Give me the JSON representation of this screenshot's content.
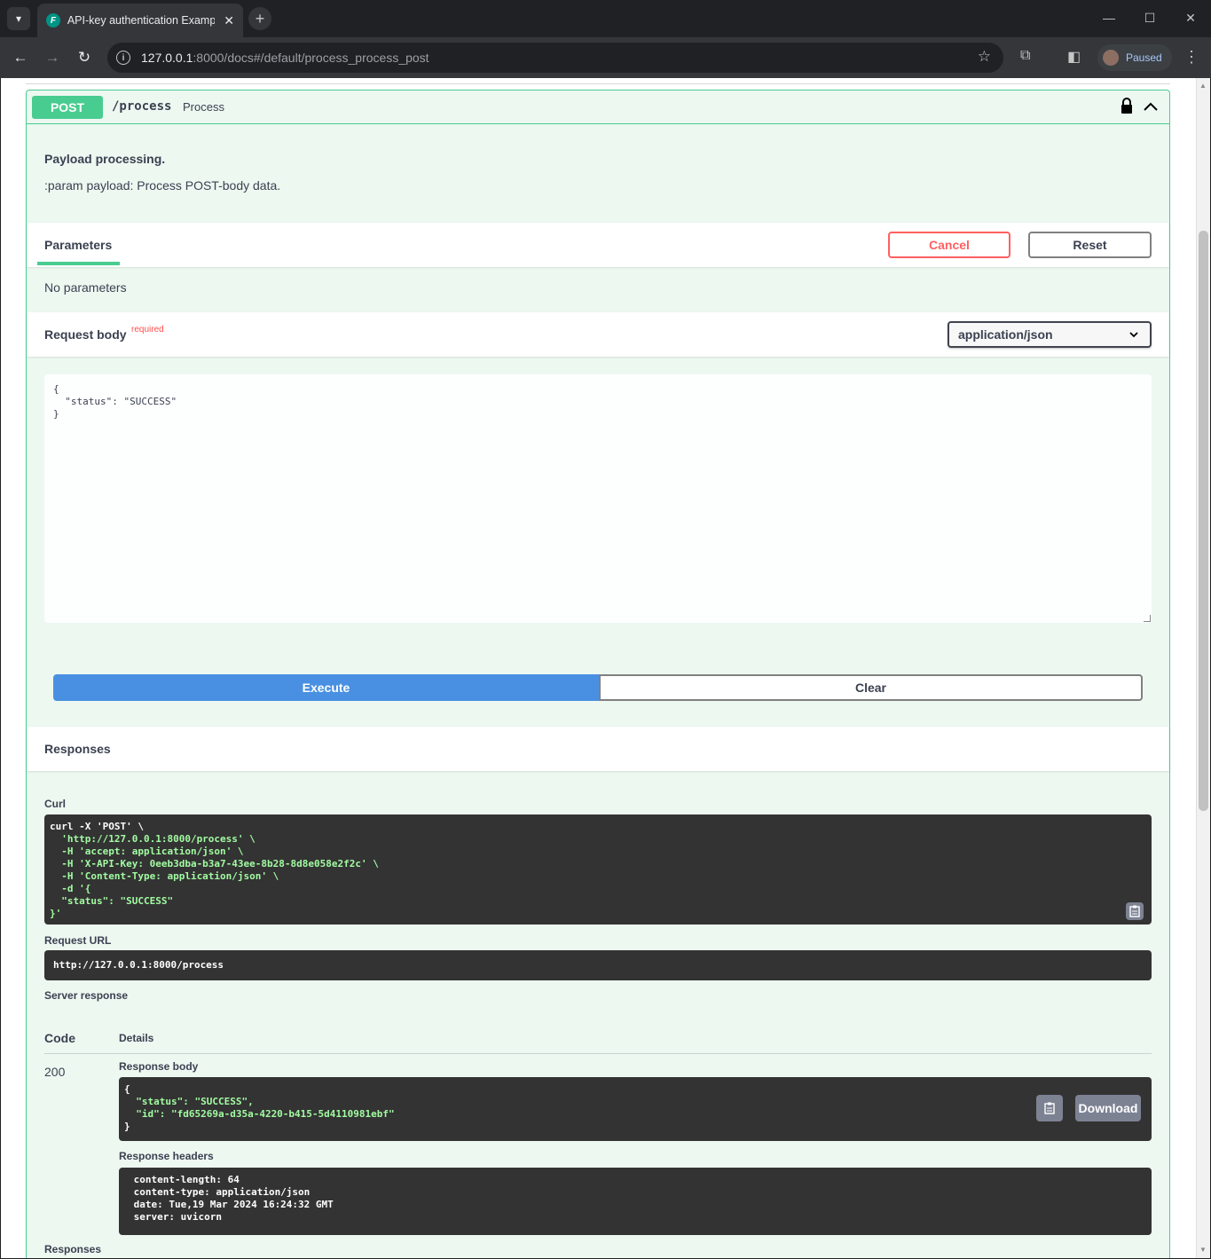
{
  "browser": {
    "tab_title": "API-key authentication Example",
    "favicon_glyph": "F",
    "url_host": "127.0.0.1",
    "url_rest": ":8000/docs#/default/process_process_post",
    "profile_label": "Paused"
  },
  "operation": {
    "method": "POST",
    "path": "/process",
    "summary": "Process",
    "description_title": "Payload processing.",
    "description_text": ":param payload: Process POST-body data."
  },
  "parameters": {
    "title": "Parameters",
    "cancel_label": "Cancel",
    "reset_label": "Reset",
    "empty_text": "No parameters"
  },
  "request_body": {
    "title": "Request body",
    "required_label": "required",
    "content_type": "application/json",
    "value": "{\n  \"status\": \"SUCCESS\"\n}"
  },
  "actions": {
    "execute_label": "Execute",
    "clear_label": "Clear"
  },
  "responses": {
    "title": "Responses",
    "curl_label": "Curl",
    "curl_lines": [
      "curl -X 'POST' \\",
      "  'http://127.0.0.1:8000/process' \\",
      "  -H 'accept: application/json' \\",
      "  -H 'X-API-Key: 0eeb3dba-b3a7-43ee-8b28-8d8e058e2f2c' \\",
      "  -H 'Content-Type: application/json' \\",
      "  -d '{",
      "  \"status\": \"SUCCESS\"",
      "}'"
    ],
    "request_url_label": "Request URL",
    "request_url": "http://127.0.0.1:8000/process",
    "server_response_label": "Server response",
    "code_header": "Code",
    "details_header": "Details",
    "status_code": "200",
    "response_body_label": "Response body",
    "response_body_lines": [
      "{",
      "  \"status\": \"SUCCESS\",",
      "  \"id\": \"fd65269a-d35a-4220-b415-5d4110981ebf\"",
      "}"
    ],
    "download_label": "Download",
    "response_headers_label": "Response headers",
    "response_headers_lines": [
      " content-length: 64 ",
      " content-type: application/json ",
      " date: Tue,19 Mar 2024 16:24:32 GMT ",
      " server: uvicorn "
    ],
    "footer_label": "Responses"
  },
  "colors": {
    "post_green": "#49cc90",
    "opblock_bg": "#edf8f1",
    "execute_blue": "#4990e2",
    "cancel_red": "#ff6060",
    "code_bg": "#333333",
    "string_green": "#a2fca2"
  }
}
